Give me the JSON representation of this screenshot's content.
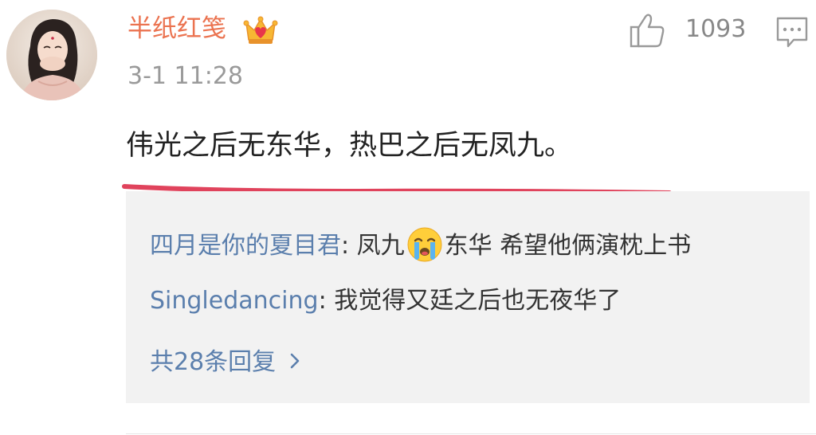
{
  "comment": {
    "username": "半纸红笺",
    "badge_icon": "crown-vip-icon",
    "timestamp": "3-1 11:28",
    "like_count": "1093",
    "text": "伟光之后无东华，热巴之后无凤九。",
    "underline_color": "#e0435c"
  },
  "replies": {
    "items": [
      {
        "author": "四月是你的夏目君",
        "colon": ": ",
        "text_before": "凤九",
        "emoji": "crying-face-icon",
        "text_after": "东华 希望他俩演枕上书"
      },
      {
        "author": "Singledancing",
        "colon": ": ",
        "text": "我觉得又廷之后也无夜华了"
      }
    ],
    "view_more": "共28条回复"
  },
  "colors": {
    "username": "#eb7350",
    "link_blue": "#5b7fad",
    "reply_bg": "#f2f2f2",
    "muted": "#9a9a9a"
  }
}
